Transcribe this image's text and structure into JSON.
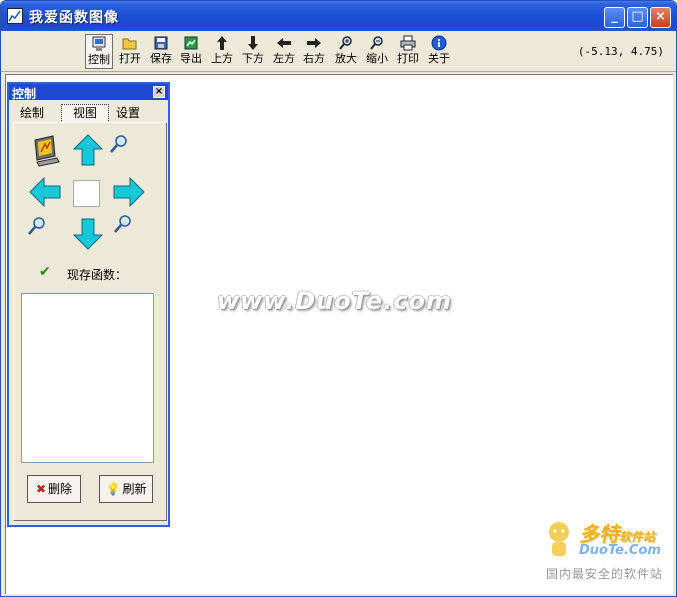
{
  "window": {
    "title": "我爱函数图像"
  },
  "titlebar_buttons": {
    "minimize": "_",
    "maximize": "□",
    "close": "×"
  },
  "toolbar": {
    "items": [
      {
        "label": "控制",
        "icon": "control-panel-icon"
      },
      {
        "label": "打开",
        "icon": "open-folder-icon"
      },
      {
        "label": "保存",
        "icon": "save-disk-icon"
      },
      {
        "label": "导出",
        "icon": "export-image-icon"
      },
      {
        "label": "上方",
        "icon": "arrow-up-icon"
      },
      {
        "label": "下方",
        "icon": "arrow-down-icon"
      },
      {
        "label": "左方",
        "icon": "arrow-left-icon"
      },
      {
        "label": "右方",
        "icon": "arrow-right-icon"
      },
      {
        "label": "放大",
        "icon": "zoom-in-icon"
      },
      {
        "label": "缩小",
        "icon": "zoom-out-icon"
      },
      {
        "label": "打印",
        "icon": "printer-icon"
      },
      {
        "label": "关于",
        "icon": "info-icon"
      }
    ],
    "coordinates": "(-5.13, 4.75)"
  },
  "panel": {
    "title": "控制",
    "close": "×",
    "tabs": [
      "绘制",
      "视图",
      "设置"
    ],
    "active_tab": "视图",
    "current_functions_label": "现存函数：",
    "delete_button": "删除",
    "refresh_button": "刷新"
  },
  "watermark": "www.DuoTe.com",
  "logo": {
    "brand": "多特",
    "brand_sub": "软件站",
    "site": "DuoTe.Com",
    "slogan": "国内最安全的软件站"
  },
  "colors": {
    "accent": "#1d4ad0",
    "arrow": "#19c8d8",
    "toolbar_bg": "#ece9d8"
  }
}
